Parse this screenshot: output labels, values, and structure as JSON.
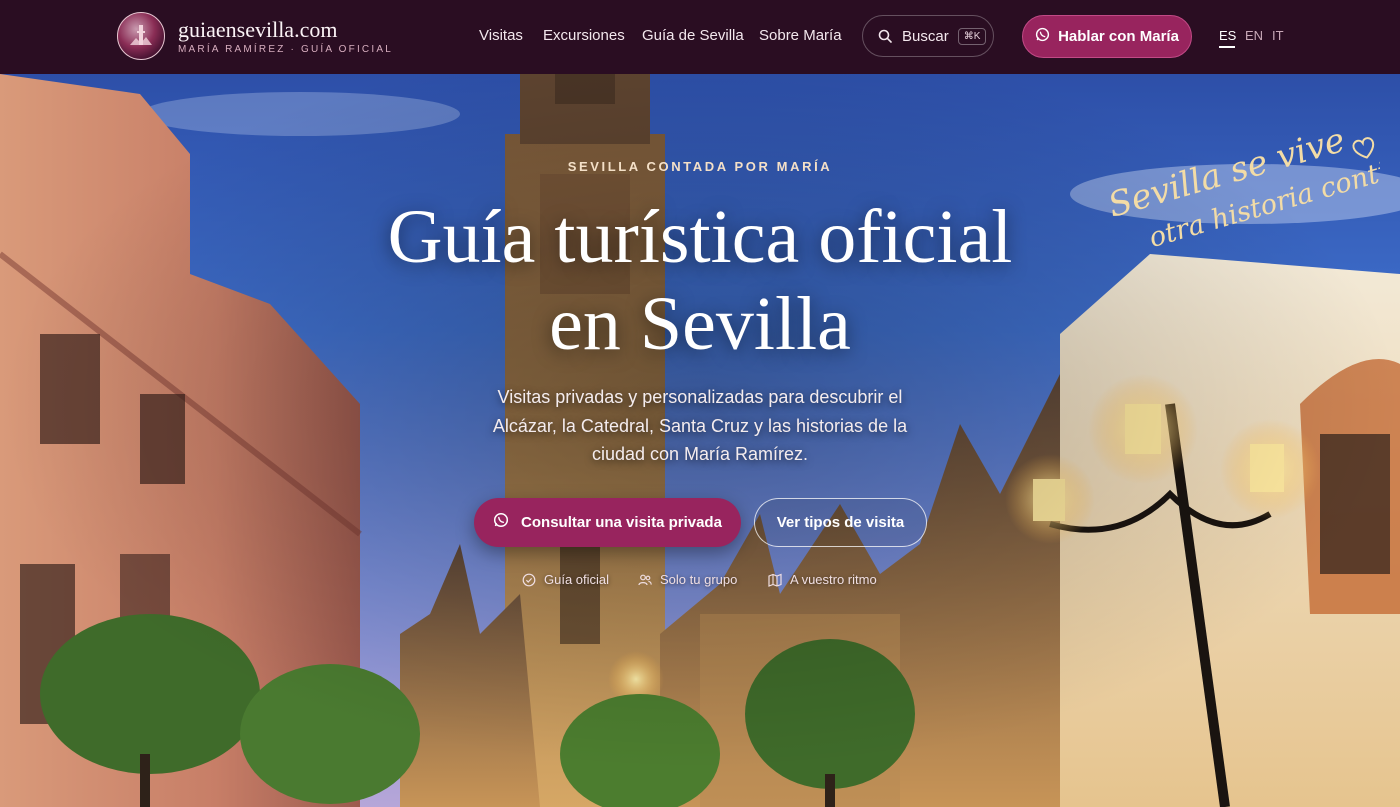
{
  "header": {
    "logo_domain": "guiaensevilla.com",
    "logo_subtitle": "MARÍA RAMÍREZ · GUÍA OFICIAL",
    "nav": [
      "Visitas",
      "Excursiones",
      "Guía de Sevilla",
      "Sobre María"
    ],
    "search_label": "Buscar",
    "search_shortcut": "⌘K",
    "cta_label": "Hablar con María",
    "languages": [
      "ES",
      "EN",
      "IT"
    ],
    "active_language": "ES"
  },
  "hero": {
    "eyebrow": "SEVILLA CONTADA POR MARÍA",
    "title_line1": "Guía turística oficial",
    "title_line2": "en Sevilla",
    "subtitle": "Visitas privadas y personalizadas para descubrir el Alcázar, la Catedral, Santa Cruz y las historias de la ciudad con María Ramírez.",
    "primary_cta": "Consultar una visita privada",
    "secondary_cta": "Ver tipos de visita",
    "features": [
      "Guía oficial",
      "Solo tu grupo",
      "A vuestro ritmo"
    ],
    "script_line1": "Sevilla se vive",
    "script_line2": "otra historia contigo"
  },
  "icons": {
    "logo": "sevilla-emblem-icon",
    "search": "search-icon",
    "whatsapp": "whatsapp-icon",
    "feature_1": "badge-check-icon",
    "feature_2": "users-icon",
    "feature_3": "map-icon",
    "heart": "heart-icon"
  },
  "colors": {
    "header_bg": "#2a0d22",
    "brand": "#98245e",
    "script_gold": "#f3dca6"
  }
}
